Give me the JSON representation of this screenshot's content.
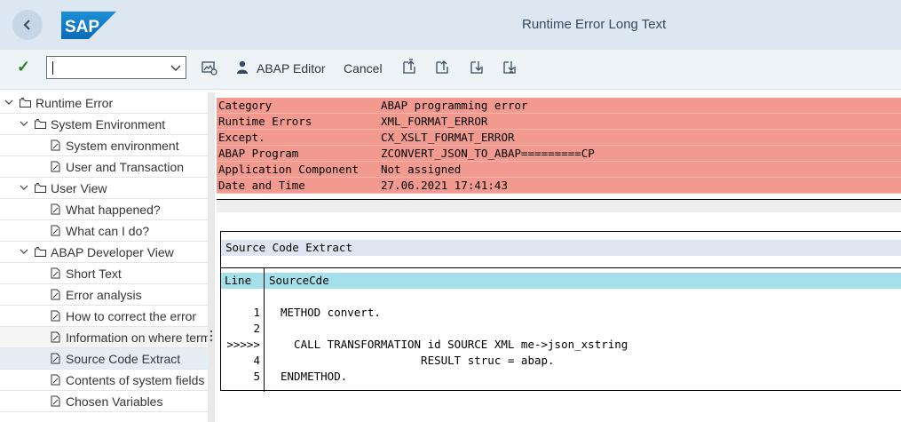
{
  "header": {
    "title": "Runtime Error Long Text",
    "logo_text": "SAP"
  },
  "toolbar": {
    "command_value": "",
    "abap_editor_label": "ABAP Editor",
    "cancel_label": "Cancel"
  },
  "tree": {
    "items": [
      {
        "label": "Runtime Error"
      },
      {
        "label": "System Environment"
      },
      {
        "label": "System environment"
      },
      {
        "label": "User and Transaction"
      },
      {
        "label": "User View"
      },
      {
        "label": "What happened?"
      },
      {
        "label": "What can I do?"
      },
      {
        "label": "ABAP Developer View"
      },
      {
        "label": "Short Text"
      },
      {
        "label": "Error analysis"
      },
      {
        "label": "How to correct the error"
      },
      {
        "label": "Information on where terminated"
      },
      {
        "label": "Source Code Extract"
      },
      {
        "label": "Contents of system fields"
      },
      {
        "label": "Chosen Variables"
      }
    ]
  },
  "error_info": [
    {
      "key": "Category",
      "value": "ABAP programming error"
    },
    {
      "key": "Runtime Errors",
      "value": "XML_FORMAT_ERROR"
    },
    {
      "key": "Except.",
      "value": "CX_XSLT_FORMAT_ERROR"
    },
    {
      "key": "ABAP Program",
      "value": "ZCONVERT_JSON_TO_ABAP=========CP"
    },
    {
      "key": "Application Component",
      "value": "Not assigned"
    },
    {
      "key": "Date and Time",
      "value": "27.06.2021 17:41:43"
    }
  ],
  "source_extract": {
    "title": "Source Code Extract",
    "col_line": "Line",
    "col_source": "SourceCde",
    "lines": [
      {
        "ln": "1",
        "code": "METHOD convert."
      },
      {
        "ln": "2",
        "code": ""
      },
      {
        "ln": ">>>>>",
        "code": "  CALL TRANSFORMATION id SOURCE XML me->json_xstring"
      },
      {
        "ln": "4",
        "code": "                     RESULT struc = abap."
      },
      {
        "ln": "5",
        "code": "ENDMETHOD."
      }
    ]
  },
  "colors": {
    "error_row": "#f29a8f",
    "header_band": "#a4e0ec",
    "title_band": "#dde6f0",
    "selected_item": "#e5edf5"
  }
}
